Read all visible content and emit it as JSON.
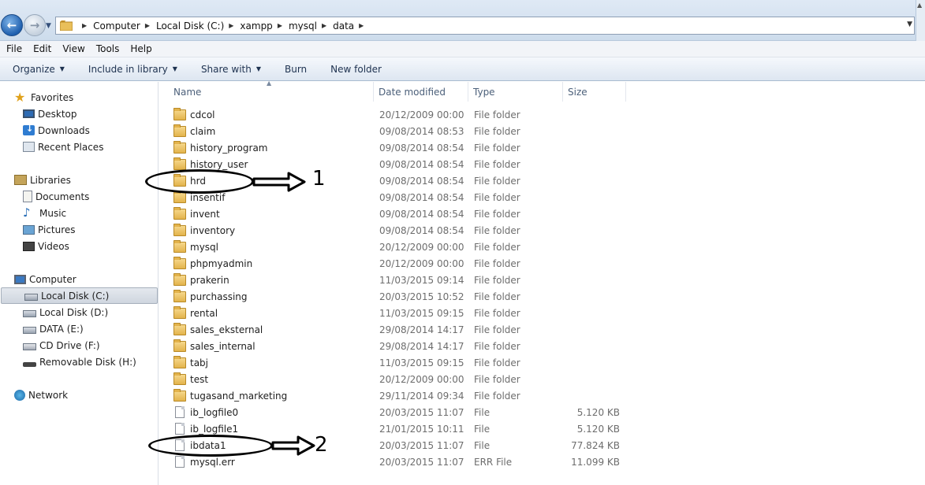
{
  "address": {
    "crumbs": [
      "Computer",
      "Local Disk (C:)",
      "xampp",
      "mysql",
      "data"
    ]
  },
  "menu": [
    "File",
    "Edit",
    "View",
    "Tools",
    "Help"
  ],
  "toolbar": {
    "organize": "Organize",
    "include": "Include in library",
    "share": "Share with",
    "burn": "Burn",
    "new_folder": "New folder"
  },
  "nav": {
    "favorites": "Favorites",
    "desktop": "Desktop",
    "downloads": "Downloads",
    "recent": "Recent Places",
    "libraries": "Libraries",
    "documents": "Documents",
    "music": "Music",
    "pictures": "Pictures",
    "videos": "Videos",
    "computer": "Computer",
    "local_c": "Local Disk (C:)",
    "local_d": "Local Disk (D:)",
    "data_e": "DATA (E:)",
    "cd_f": "CD Drive (F:)",
    "removable_h": "Removable Disk (H:)",
    "network": "Network"
  },
  "columns": {
    "name": "Name",
    "date": "Date modified",
    "type": "Type",
    "size": "Size"
  },
  "files": [
    {
      "name": "cdcol",
      "date": "20/12/2009 00:00",
      "type": "File folder",
      "size": "",
      "kind": "folder"
    },
    {
      "name": "claim",
      "date": "09/08/2014 08:53",
      "type": "File folder",
      "size": "",
      "kind": "folder"
    },
    {
      "name": "history_program",
      "date": "09/08/2014 08:54",
      "type": "File folder",
      "size": "",
      "kind": "folder"
    },
    {
      "name": "history_user",
      "date": "09/08/2014 08:54",
      "type": "File folder",
      "size": "",
      "kind": "folder"
    },
    {
      "name": "hrd",
      "date": "09/08/2014 08:54",
      "type": "File folder",
      "size": "",
      "kind": "folder"
    },
    {
      "name": "insentif",
      "date": "09/08/2014 08:54",
      "type": "File folder",
      "size": "",
      "kind": "folder"
    },
    {
      "name": "invent",
      "date": "09/08/2014 08:54",
      "type": "File folder",
      "size": "",
      "kind": "folder"
    },
    {
      "name": "inventory",
      "date": "09/08/2014 08:54",
      "type": "File folder",
      "size": "",
      "kind": "folder"
    },
    {
      "name": "mysql",
      "date": "20/12/2009 00:00",
      "type": "File folder",
      "size": "",
      "kind": "folder"
    },
    {
      "name": "phpmyadmin",
      "date": "20/12/2009 00:00",
      "type": "File folder",
      "size": "",
      "kind": "folder"
    },
    {
      "name": "prakerin",
      "date": "11/03/2015 09:14",
      "type": "File folder",
      "size": "",
      "kind": "folder"
    },
    {
      "name": "purchassing",
      "date": "20/03/2015 10:52",
      "type": "File folder",
      "size": "",
      "kind": "folder"
    },
    {
      "name": "rental",
      "date": "11/03/2015 09:15",
      "type": "File folder",
      "size": "",
      "kind": "folder"
    },
    {
      "name": "sales_eksternal",
      "date": "29/08/2014 14:17",
      "type": "File folder",
      "size": "",
      "kind": "folder"
    },
    {
      "name": "sales_internal",
      "date": "29/08/2014 14:17",
      "type": "File folder",
      "size": "",
      "kind": "folder"
    },
    {
      "name": "tabj",
      "date": "11/03/2015 09:15",
      "type": "File folder",
      "size": "",
      "kind": "folder"
    },
    {
      "name": "test",
      "date": "20/12/2009 00:00",
      "type": "File folder",
      "size": "",
      "kind": "folder"
    },
    {
      "name": "tugasand_marketing",
      "date": "29/11/2014 09:34",
      "type": "File folder",
      "size": "",
      "kind": "folder"
    },
    {
      "name": "ib_logfile0",
      "date": "20/03/2015 11:07",
      "type": "File",
      "size": "5.120 KB",
      "kind": "file"
    },
    {
      "name": "ib_logfile1",
      "date": "21/01/2015 10:11",
      "type": "File",
      "size": "5.120 KB",
      "kind": "file"
    },
    {
      "name": "ibdata1",
      "date": "20/03/2015 11:07",
      "type": "File",
      "size": "77.824 KB",
      "kind": "file"
    },
    {
      "name": "mysql.err",
      "date": "20/03/2015 11:07",
      "type": "ERR File",
      "size": "11.099 KB",
      "kind": "file"
    }
  ],
  "annotations": {
    "marker1": "1",
    "marker2": "2"
  }
}
